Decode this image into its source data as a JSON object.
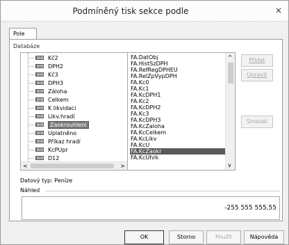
{
  "window": {
    "title": "Podmíněný tisk sekce podle",
    "close_glyph": "×"
  },
  "tabs": [
    {
      "label": "Pole"
    }
  ],
  "database_label": "Databáze",
  "tree": {
    "items": [
      {
        "label": "Kč2"
      },
      {
        "label": "DPH2"
      },
      {
        "label": "Kč3"
      },
      {
        "label": "DPH3"
      },
      {
        "label": "Záloha"
      },
      {
        "label": "Celkem"
      },
      {
        "label": "K likvidaci"
      },
      {
        "label": "Likv.hradí"
      },
      {
        "label": "Zaokrouhlení",
        "selected": true
      },
      {
        "label": "Uplatněno"
      },
      {
        "label": "Příkaz hradí"
      },
      {
        "label": "KcPUpr"
      },
      {
        "label": "D12"
      }
    ],
    "scroll_left": "<",
    "scroll_right": ">"
  },
  "fields": {
    "items": [
      {
        "label": "FA.DatObj"
      },
      {
        "label": "FA.HistSzDPH"
      },
      {
        "label": "FA.RefRegDPHEU"
      },
      {
        "label": "FA.RelZpVypDPH"
      },
      {
        "label": "FA.Kc0"
      },
      {
        "label": "FA.Kc1"
      },
      {
        "label": "FA.KcDPH1"
      },
      {
        "label": "FA.Kc2"
      },
      {
        "label": "FA.KcDPH2"
      },
      {
        "label": "FA.Kc3"
      },
      {
        "label": "FA.KcDPH3"
      },
      {
        "label": "FA.KcZaloha"
      },
      {
        "label": "FA.KcCelkem"
      },
      {
        "label": "FA.KcLikv"
      },
      {
        "label": "FA.KcU"
      },
      {
        "label": "FA.KcZaokr",
        "selected": true
      },
      {
        "label": "FA.KcUhrk"
      }
    ],
    "scroll_up": "^",
    "scroll_down": "v"
  },
  "side_buttons": {
    "add": "Přidat",
    "edit": "Upravit",
    "delete": "Smazat"
  },
  "data_type": "Datový typ: Peníze",
  "preview_label": "Náhled",
  "preview_value": "-255 555 555,55",
  "buttons": {
    "ok": "OK",
    "cancel": "Storno",
    "apply": "Použít",
    "help": "Nápověda"
  },
  "colors": {
    "selection": "#5a5a5a",
    "disabled_text": "#a8a8a8"
  }
}
